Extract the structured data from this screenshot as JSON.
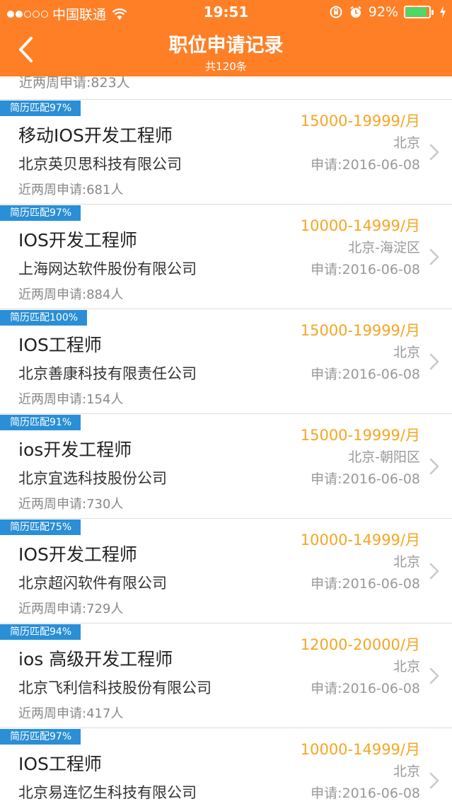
{
  "status_bar": {
    "carrier": "中国联通",
    "time": "19:51",
    "battery": "92%",
    "battery_level": 0.92
  },
  "nav": {
    "title": "职位申请记录",
    "subtitle": "共120条"
  },
  "partial_row": {
    "count_text": "近两周申请:823人"
  },
  "jobs": [
    {
      "match": "简历匹配97%",
      "title": "移动IOS开发工程师",
      "company": "北京英贝思科技有限公司",
      "count": "近两周申请:681人",
      "salary": "15000-19999/月",
      "location": "北京",
      "date": "申请:2016-06-08"
    },
    {
      "match": "简历匹配97%",
      "title": "IOS开发工程师",
      "company": "上海网达软件股份有限公司",
      "count": "近两周申请:884人",
      "salary": "10000-14999/月",
      "location": "北京-海淀区",
      "date": "申请:2016-06-08"
    },
    {
      "match": "简历匹配100%",
      "title": "IOS工程师",
      "company": "北京善康科技有限责任公司",
      "count": "近两周申请:154人",
      "salary": "15000-19999/月",
      "location": "北京",
      "date": "申请:2016-06-08"
    },
    {
      "match": "简历匹配91%",
      "title": "ios开发工程师",
      "company": "北京宜选科技股份公司",
      "count": "近两周申请:730人",
      "salary": "15000-19999/月",
      "location": "北京-朝阳区",
      "date": "申请:2016-06-08"
    },
    {
      "match": "简历匹配75%",
      "title": "IOS开发工程师",
      "company": "北京超闪软件有限公司",
      "count": "近两周申请:729人",
      "salary": "10000-14999/月",
      "location": "北京",
      "date": "申请:2016-06-08"
    },
    {
      "match": "简历匹配94%",
      "title": "ios 高级开发工程师",
      "company": "北京飞利信科技股份有限公司",
      "count": "近两周申请:417人",
      "salary": "12000-20000/月",
      "location": "北京",
      "date": "申请:2016-06-08"
    },
    {
      "match": "简历匹配97%",
      "title": "IOS工程师",
      "company": "北京易连忆生科技有限公司",
      "count": "",
      "salary": "10000-14999/月",
      "location": "北京",
      "date": "申请:2016-06-08"
    }
  ],
  "colors": {
    "header": "#FF7F27",
    "badge": "#2A8FD6",
    "salary": "#F5A623",
    "battery": "#4CD964"
  }
}
